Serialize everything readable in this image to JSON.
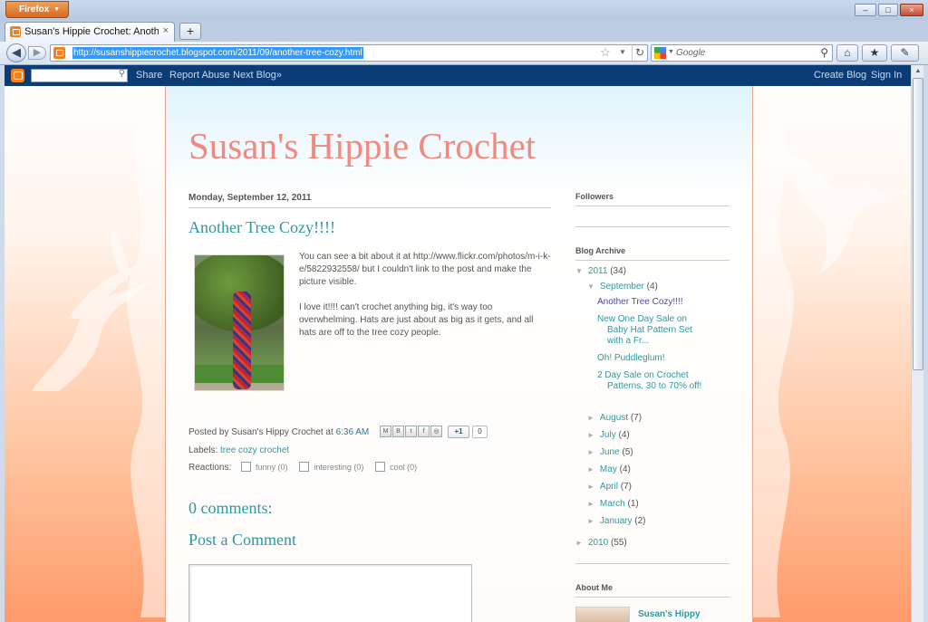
{
  "browser": {
    "menu_button": "Firefox",
    "tab_title": "Susan's Hippie Crochet: Another Tree C...",
    "tab_close": "×",
    "new_tab": "+",
    "url": "http://susanshippiecrochet.blogspot.com/2011/09/another-tree-cozy.html",
    "search_placeholder": "Google",
    "window_controls": [
      "–",
      "□",
      "×"
    ]
  },
  "blogger_nav": {
    "links": [
      "Share",
      "Report Abuse",
      "Next Blog»"
    ],
    "right_links": [
      "Create Blog",
      "Sign In"
    ]
  },
  "blog": {
    "title": "Susan's Hippie Crochet"
  },
  "post": {
    "date": "Monday, September 12, 2011",
    "title": "Another Tree Cozy!!!!",
    "paragraphs": [
      "You can see a bit about it at http://www.flickr.com/photos/m-i-k-e/5822932558/ but I couldn't link to the post and make the picture visible.",
      "I love it!!!! can't crochet anything big, it's way too overwhelming. Hats are just about as big as it gets, and all hats are off to the tree cozy people."
    ],
    "posted_by": "Posted by Susan's Hippy Crochet at",
    "time": "6:36 AM",
    "plusone": "+1",
    "plusone_count": "0",
    "labels_prefix": "Labels:",
    "labels": "tree cozy crochet",
    "reactions_prefix": "Reactions:",
    "reactions": [
      "funny (0)",
      "interesting (0)",
      "cool (0)"
    ]
  },
  "comments": {
    "count_heading": "0 comments:",
    "post_heading": "Post a Comment"
  },
  "sidebar": {
    "followers_heading": "Followers",
    "archive_heading": "Blog Archive",
    "year_2011": "2011",
    "year_2011_count": "(34)",
    "september": "September",
    "september_count": "(4)",
    "september_posts": [
      "Another Tree Cozy!!!!",
      "New One Day Sale on Baby Hat Pattern Set with a Fr...",
      "Oh! Puddleglum!",
      "2 Day Sale on Crochet Patterns, 30 to 70% off!"
    ],
    "months": [
      {
        "name": "August",
        "count": "(7)"
      },
      {
        "name": "July",
        "count": "(4)"
      },
      {
        "name": "June",
        "count": "(5)"
      },
      {
        "name": "May",
        "count": "(4)"
      },
      {
        "name": "April",
        "count": "(7)"
      },
      {
        "name": "March",
        "count": "(1)"
      },
      {
        "name": "January",
        "count": "(2)"
      }
    ],
    "year_2010": "2010",
    "year_2010_count": "(55)",
    "about_heading": "About Me",
    "about_name": "Susan's Hippy"
  },
  "colors": {
    "accent": "#2a9aa0",
    "title": "#f08a80",
    "blogger_bar": "#0b3c76",
    "blogger_orange": "#f48120"
  }
}
